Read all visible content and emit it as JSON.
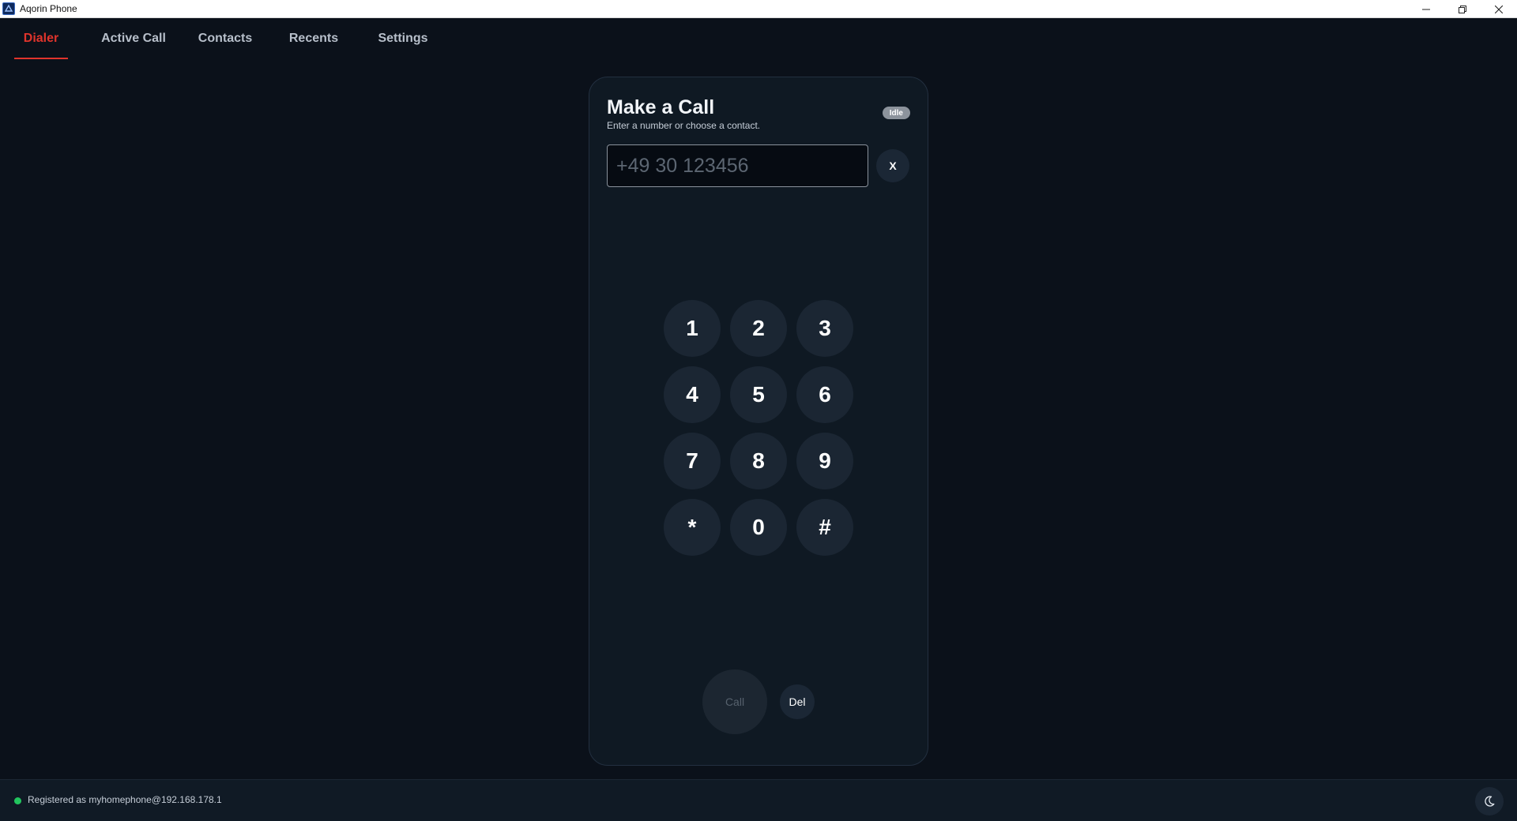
{
  "window": {
    "title": "Aqorin Phone",
    "icon": "app-logo-icon",
    "controls": [
      "minimize-icon",
      "restore-icon",
      "close-icon"
    ]
  },
  "tabs": [
    {
      "label": "Dialer",
      "active": true
    },
    {
      "label": "Active Call",
      "active": false
    },
    {
      "label": "Contacts",
      "active": false
    },
    {
      "label": "Recents",
      "active": false
    },
    {
      "label": "Settings",
      "active": false
    }
  ],
  "dialer": {
    "title": "Make a Call",
    "subtitle": "Enter a number or choose a contact.",
    "status": "Idle",
    "input": {
      "value": "",
      "placeholder": "+49 30 123456"
    },
    "clear_label": "X",
    "keys": [
      "1",
      "2",
      "3",
      "4",
      "5",
      "6",
      "7",
      "8",
      "9",
      "*",
      "0",
      "#"
    ],
    "call_label": "Call",
    "del_label": "Del"
  },
  "statusbar": {
    "registration": "Registered as myhomephone@192.168.178.1",
    "indicator_color": "#22c55e",
    "theme_icon": "moon-icon"
  },
  "colors": {
    "accent": "#e0342c",
    "background": "#0b111a"
  }
}
